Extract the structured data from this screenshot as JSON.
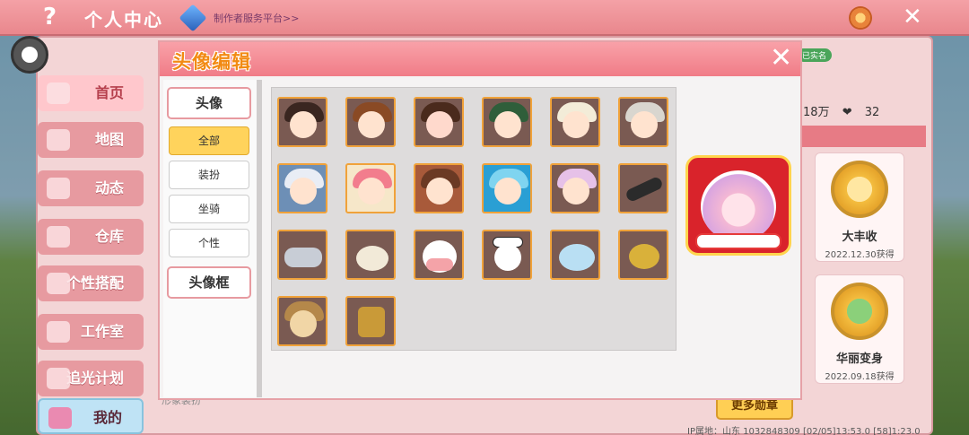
{
  "topbar": {
    "help": "?",
    "title": "个人中心",
    "link": "制作者服务平台>>",
    "close": "✕"
  },
  "sidebar": {
    "items": [
      {
        "label": "首页",
        "icon": "home-icon",
        "active": true
      },
      {
        "label": "地图",
        "icon": "map-icon"
      },
      {
        "label": "动态",
        "icon": "feed-icon"
      },
      {
        "label": "仓库",
        "icon": "storage-icon"
      },
      {
        "label": "个性搭配",
        "icon": "outfit-icon"
      },
      {
        "label": "工作室",
        "icon": "studio-icon"
      },
      {
        "label": "追光计划",
        "icon": "light-icon"
      },
      {
        "label": "我的",
        "icon": "heart-icon"
      }
    ]
  },
  "background": {
    "tag": "已实名",
    "stat_fans": "18万",
    "stat_likes": "32",
    "medals": [
      {
        "name": "大丰收",
        "date": "2022.12.30获得"
      },
      {
        "name": "华丽变身",
        "date": "2022.09.18获得"
      }
    ],
    "more_medals": "更多勋章",
    "footer": "IP属地：山东  1032848309  [02/05]13:53.0  [58]1:23.0",
    "partial_title": "形象装扮"
  },
  "modal": {
    "title": "头像编辑",
    "close": "✕",
    "tab_avatar": "头像",
    "tab_frame": "头像框",
    "subtabs": [
      "全部",
      "装扮",
      "坐骑",
      "个性"
    ],
    "active_subtab": "全部"
  },
  "colors": {
    "accent_pink": "#f07c87",
    "selected_tab": "#ffd35c",
    "title_orange": "#f28a13"
  }
}
